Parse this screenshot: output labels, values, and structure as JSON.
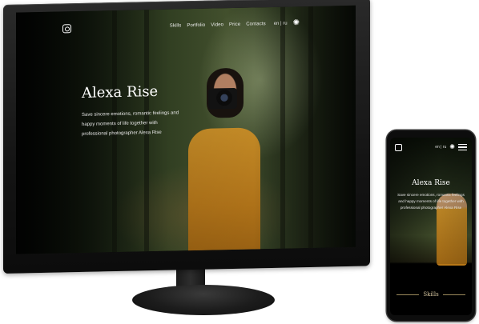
{
  "desktop": {
    "nav": {
      "logo_icon": "camera-logo-icon",
      "links": [
        "Skills",
        "Portfolio",
        "Video",
        "Price",
        "Contacts"
      ],
      "language": "en | ru",
      "theme_icon": "sun-icon"
    },
    "hero": {
      "title": "Alexa Rise",
      "text": "Save sincere emotions, romantic feelings and happy moments of life together with professional photographer Alexa Rise"
    }
  },
  "mobile": {
    "nav": {
      "logo_icon": "camera-logo-icon",
      "language": "en | ru",
      "theme_icon": "sun-icon",
      "menu_icon": "hamburger-menu-icon"
    },
    "hero": {
      "title": "Alexa Rise",
      "text": "Save sincere emotions, romantic feelings and happy moments of life together with professional photographer Alexa Rise"
    },
    "section_heading": "Skills"
  },
  "colors": {
    "hero_text": "#ffffff",
    "accent_gold": "#d7c7a0",
    "sweater": "#d99a2b"
  }
}
